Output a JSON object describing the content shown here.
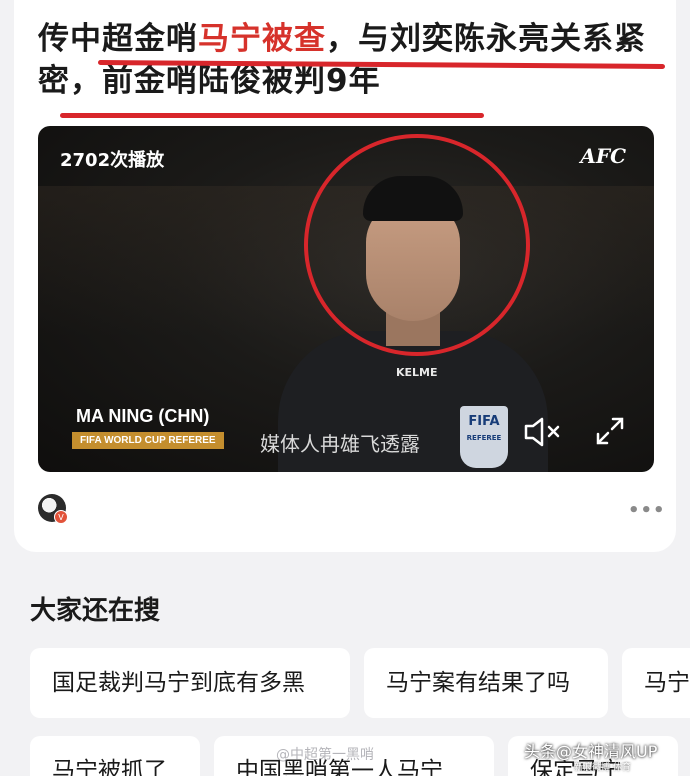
{
  "headline": {
    "part1": "传中超金哨",
    "highlight": "马宁被查",
    "part2": "，与刘奕陈永亮关系紧密，前金哨陆俊被判9年"
  },
  "video": {
    "play_count": "2702次播放",
    "logo": "AFC",
    "person_name": "MA NING (CHN)",
    "person_title": "FIFA WORLD CUP REFEREE",
    "caption": "媒体人冉雄飞透露",
    "shirt_brand": "KELME",
    "badge_text": "FIFA",
    "badge_sub": "REFEREE",
    "controls": {
      "mute_icon": "mute-icon",
      "fullscreen_icon": "fullscreen-icon"
    }
  },
  "author": {
    "avatar": "avatar",
    "badge": "V"
  },
  "more_label": "•••",
  "search_section": {
    "title": "大家还在搜",
    "chips": [
      "国足裁判马宁到底有多黑",
      "马宁案有结果了吗",
      "马宁",
      "马宁被抓了",
      "中国黑哨第一人马宁",
      "保定马宁"
    ]
  },
  "watermarks": {
    "center": "@中超第一黑哨",
    "right": "头条@女神清风UP",
    "right_small": "新浪微博 体育"
  },
  "colors": {
    "accent_red": "#d8262b",
    "gold_bar": "#c48e2e"
  }
}
